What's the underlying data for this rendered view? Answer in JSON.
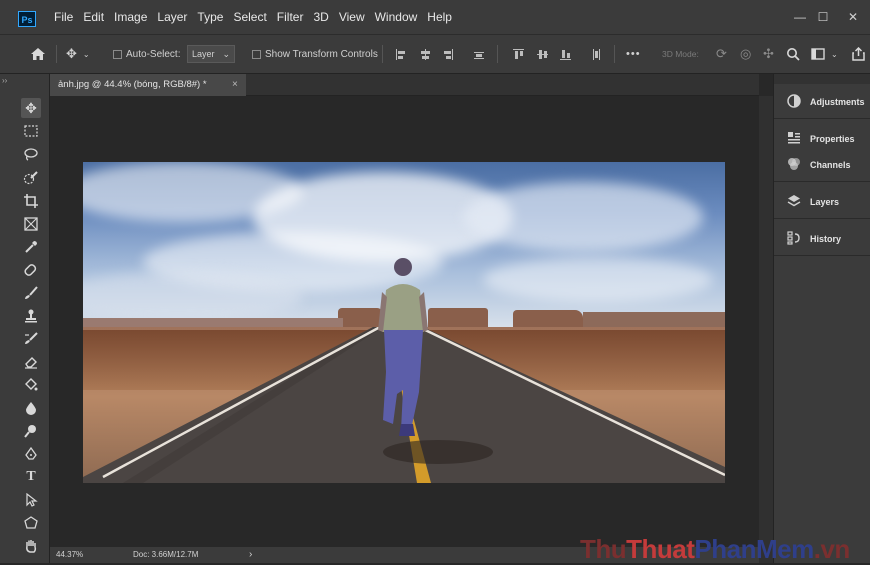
{
  "app": {
    "logo": "Ps"
  },
  "menu": [
    "File",
    "Edit",
    "Image",
    "Layer",
    "Type",
    "Select",
    "Filter",
    "3D",
    "View",
    "Window",
    "Help"
  ],
  "window_controls": {
    "minimize": "—",
    "maximize": "☐",
    "close": "✕"
  },
  "options_bar": {
    "auto_select_label": "Auto-Select:",
    "layer_dropdown": "Layer",
    "show_transform_label": "Show Transform Controls",
    "more_label": "•••",
    "mode_3d_label": "3D Mode:"
  },
  "document_tab": {
    "title": "ảnh.jpg @ 44.4% (bóng, RGB/8#) *",
    "close": "×"
  },
  "status_bar": {
    "zoom": "44.37%",
    "doc_info": "Doc: 3.66M/12.7M",
    "arrow": "›"
  },
  "panels": [
    {
      "label": "Adjustments",
      "icon": "adjustments-icon"
    },
    {
      "label": "Properties",
      "icon": "properties-icon"
    },
    {
      "label": "Channels",
      "icon": "channels-icon"
    },
    {
      "label": "Layers",
      "icon": "layers-icon"
    },
    {
      "label": "History",
      "icon": "history-icon"
    }
  ],
  "tools": [
    "move",
    "marquee",
    "lasso",
    "quick-selection",
    "crop",
    "frame",
    "eyedropper",
    "healing",
    "brush",
    "clone-stamp",
    "history-brush",
    "eraser",
    "paint-bucket",
    "blur",
    "dodge",
    "pen",
    "type",
    "path-selection",
    "shape",
    "hand"
  ],
  "watermark": {
    "part1": "Thu",
    "part2": "Thuat",
    "part3": "PhanMem",
    "part4": ".vn"
  }
}
